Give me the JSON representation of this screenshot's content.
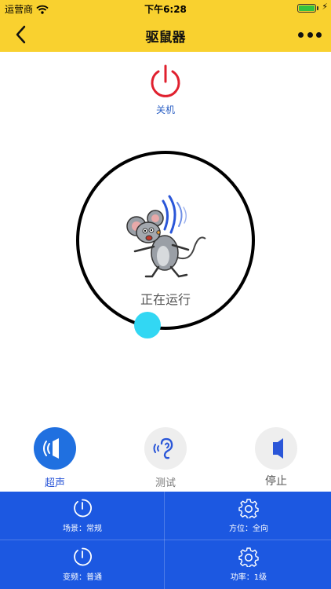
{
  "status_bar": {
    "carrier": "运营商",
    "time": "下午6:28",
    "battery_level": 1.0
  },
  "nav": {
    "title": "驱鼠器"
  },
  "power": {
    "label": "关机"
  },
  "dial": {
    "status": "正在运行",
    "level": 0
  },
  "modes": [
    {
      "label": "超声",
      "icon": "speaker-wave-icon",
      "selected": true
    },
    {
      "label": "测试",
      "icon": "ear-sound-icon",
      "selected": false
    },
    {
      "label": "停止",
      "icon": "speaker-icon",
      "selected": false
    }
  ],
  "settings": [
    {
      "label": "场景：常规",
      "icon": "timer-icon"
    },
    {
      "label": "方位：全向",
      "icon": "gear-icon"
    },
    {
      "label": "变频：普通",
      "icon": "timer-icon"
    },
    {
      "label": "功率：1级",
      "icon": "gear-icon"
    }
  ],
  "colors": {
    "nav_bg": "#f9d12f",
    "panel_bg": "#1c58e1",
    "power_red": "#e0202e",
    "accent_blue": "#2070e0",
    "knob_cyan": "#32d7f3"
  }
}
